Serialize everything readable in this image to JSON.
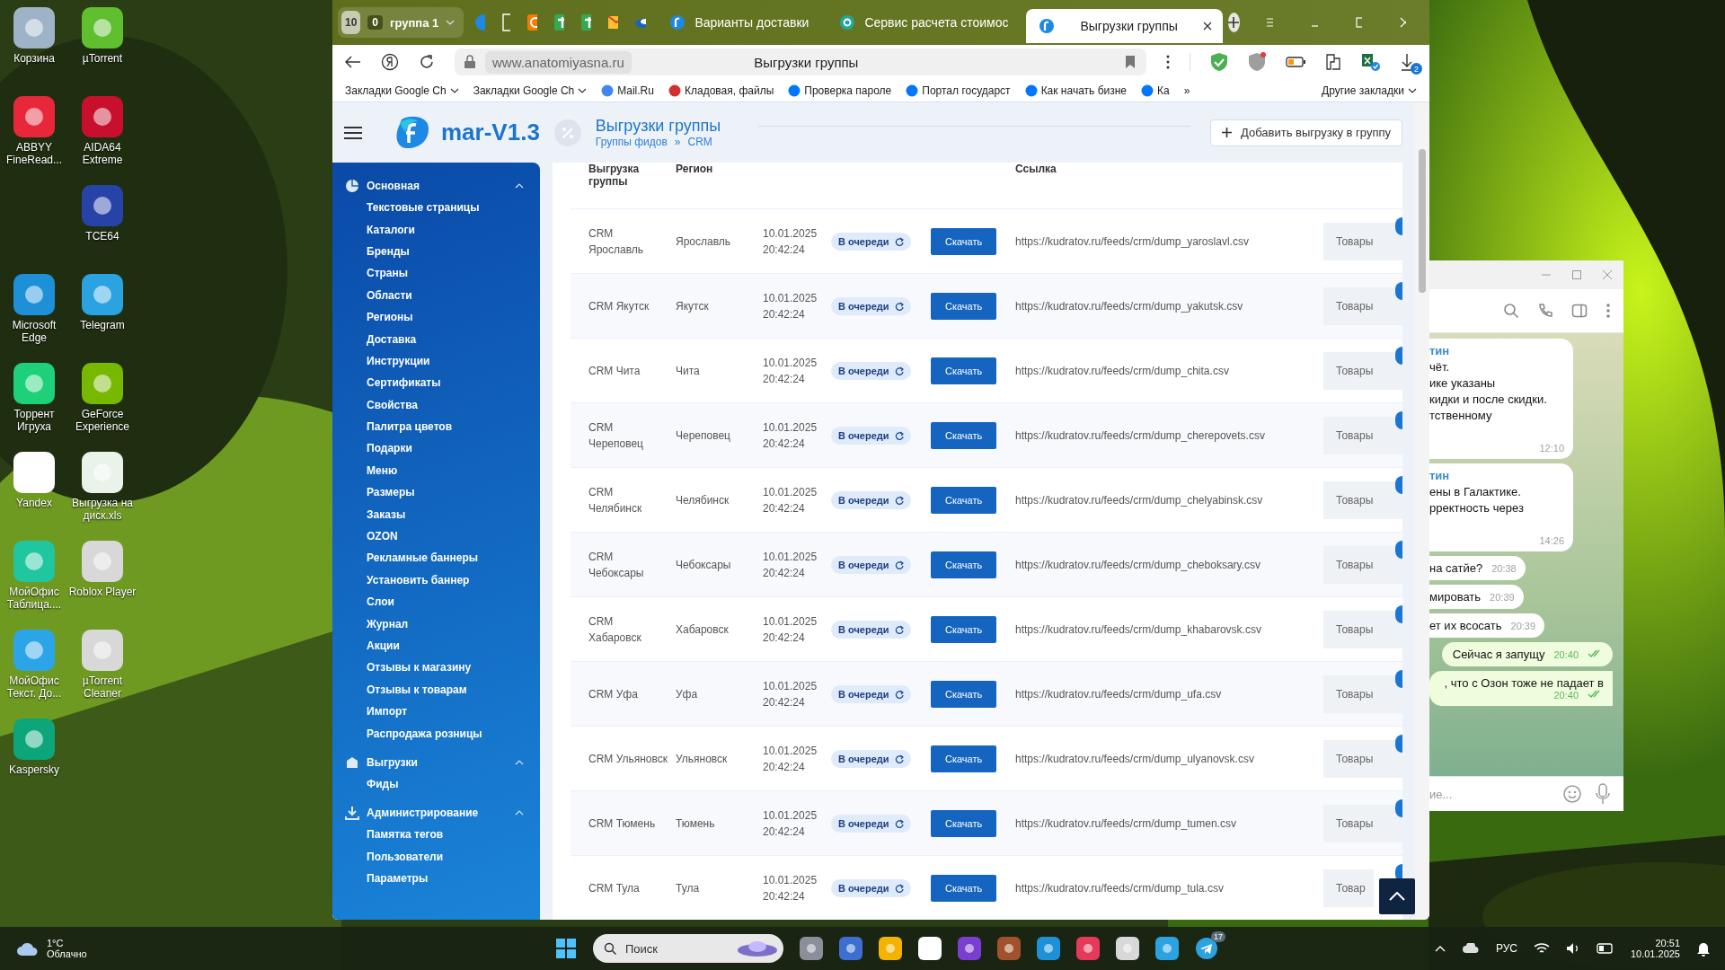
{
  "desktop": {
    "icons": [
      {
        "label": "Корзина"
      },
      {
        "label": "µTorrent"
      },
      {
        "label": "ABBYY FineRead..."
      },
      {
        "label": "AIDA64 Extreme"
      },
      {
        "label": "TCE64"
      },
      {
        "label": "Microsoft Edge"
      },
      {
        "label": "Telegram"
      },
      {
        "label": "Торрент Игруха"
      },
      {
        "label": "GeForce Experience"
      },
      {
        "label": "Yandex"
      },
      {
        "label": "Выгрузка на диск.xls"
      },
      {
        "label": "МойОфис Таблица...."
      },
      {
        "label": "Roblox Player"
      },
      {
        "label": "МойОфис Текст. До..."
      },
      {
        "label": "µTorrent Cleaner"
      },
      {
        "label": "Kaspersky"
      }
    ]
  },
  "browser": {
    "tab_group": {
      "count": "10",
      "badge": "0",
      "label": "группа 1"
    },
    "tabs": [
      {
        "title": "Варианты доставки",
        "selected": false
      },
      {
        "title": "Сервис расчета стоимос",
        "selected": false
      },
      {
        "title": "Выгрузки группы",
        "selected": true
      }
    ],
    "address": {
      "url": "www.anatomiyasna.ru",
      "page_title": "Выгрузки группы"
    },
    "download_badge": "2",
    "bookmarks": [
      {
        "label": "Закладки Google Ch",
        "kind": "folder"
      },
      {
        "label": "Закладки Google Ch",
        "kind": "folder"
      },
      {
        "label": "Mail.Ru",
        "kind": "link"
      },
      {
        "label": "Кладовая, файлы",
        "kind": "link"
      },
      {
        "label": "Проверка пароле",
        "kind": "link"
      },
      {
        "label": "Портал государст",
        "kind": "link"
      },
      {
        "label": "Как начать бизне",
        "kind": "link"
      },
      {
        "label": "Ка",
        "kind": "link"
      }
    ],
    "bookmarks_more": "»",
    "other_bookmarks": "Другие закладки"
  },
  "page": {
    "logo": "mar-V1.3",
    "title": "Выгрузки группы",
    "breadcrumbs": [
      "Группы фидов",
      "CRM"
    ],
    "breadcrumb_separator": "»",
    "add_button": "Добавить выгрузку в группу",
    "sidebar": [
      {
        "title": "Основная",
        "expanded": true,
        "items": [
          "Текстовые страницы",
          "Каталоги",
          "Бренды",
          "Страны",
          "Области",
          "Регионы",
          "Доставка",
          "Инструкции",
          "Сертификаты",
          "Свойства",
          "Палитра цветов",
          "Подарки",
          "Меню",
          "Размеры",
          "Заказы",
          "OZON",
          "Рекламные баннеры",
          "Установить баннер",
          "Слои",
          "Журнал",
          "Акции",
          "Отзывы к магазину",
          "Отзывы к товарам",
          "Импорт",
          "Распродажа розницы"
        ]
      },
      {
        "title": "Выгрузки",
        "expanded": true,
        "items": [
          "Фиды"
        ]
      },
      {
        "title": "Администрирование",
        "expanded": true,
        "items": [
          "Памятка тегов",
          "Пользователи",
          "Параметры"
        ]
      }
    ],
    "table": {
      "headers": {
        "group": "Выгрузка группы",
        "region": "Регион",
        "link": "Ссылка"
      },
      "rows": [
        {
          "group": "CRM Ярославль",
          "region": "Ярославль",
          "date": "10.01.2025",
          "time": "20:42:24",
          "status": "В очереди",
          "download": "Скачать",
          "link": "https://kudratov.ru/feeds/crm/dump_yaroslavl.csv",
          "products": "Товары"
        },
        {
          "group": "CRM Якутск",
          "region": "Якутск",
          "date": "10.01.2025",
          "time": "20:42:24",
          "status": "В очереди",
          "download": "Скачать",
          "link": "https://kudratov.ru/feeds/crm/dump_yakutsk.csv",
          "products": "Товары"
        },
        {
          "group": "CRM Чита",
          "region": "Чита",
          "date": "10.01.2025",
          "time": "20:42:24",
          "status": "В очереди",
          "download": "Скачать",
          "link": "https://kudratov.ru/feeds/crm/dump_chita.csv",
          "products": "Товары"
        },
        {
          "group": "CRM Череповец",
          "region": "Череповец",
          "date": "10.01.2025",
          "time": "20:42:24",
          "status": "В очереди",
          "download": "Скачать",
          "link": "https://kudratov.ru/feeds/crm/dump_cherepovets.csv",
          "products": "Товары"
        },
        {
          "group": "CRM Челябинск",
          "region": "Челябинск",
          "date": "10.01.2025",
          "time": "20:42:24",
          "status": "В очереди",
          "download": "Скачать",
          "link": "https://kudratov.ru/feeds/crm/dump_chelyabinsk.csv",
          "products": "Товары"
        },
        {
          "group": "CRM Чебоксары",
          "region": "Чебоксары",
          "date": "10.01.2025",
          "time": "20:42:24",
          "status": "В очереди",
          "download": "Скачать",
          "link": "https://kudratov.ru/feeds/crm/dump_cheboksary.csv",
          "products": "Товары"
        },
        {
          "group": "CRM Хабаровск",
          "region": "Хабаровск",
          "date": "10.01.2025",
          "time": "20:42:24",
          "status": "В очереди",
          "download": "Скачать",
          "link": "https://kudratov.ru/feeds/crm/dump_khabarovsk.csv",
          "products": "Товары"
        },
        {
          "group": "CRM Уфа",
          "region": "Уфа",
          "date": "10.01.2025",
          "time": "20:42:24",
          "status": "В очереди",
          "download": "Скачать",
          "link": "https://kudratov.ru/feeds/crm/dump_ufa.csv",
          "products": "Товары"
        },
        {
          "group": "CRM Ульяновск",
          "region": "Ульяновск",
          "date": "10.01.2025",
          "time": "20:42:24",
          "status": "В очереди",
          "download": "Скачать",
          "link": "https://kudratov.ru/feeds/crm/dump_ulyanovsk.csv",
          "products": "Товары"
        },
        {
          "group": "CRM Тюмень",
          "region": "Тюмень",
          "date": "10.01.2025",
          "time": "20:42:24",
          "status": "В очереди",
          "download": "Скачать",
          "link": "https://kudratov.ru/feeds/crm/dump_tumen.csv",
          "products": "Товары"
        },
        {
          "group": "CRM Тула",
          "region": "Тула",
          "date": "10.01.2025",
          "time": "20:42:24",
          "status": "В очереди",
          "download": "Скачать",
          "link": "https://kudratov.ru/feeds/crm/dump_tula.csv",
          "products": "Товар"
        }
      ]
    }
  },
  "telegram": {
    "messages": [
      {
        "kind": "incoming",
        "sender": "тин",
        "lines": [
          "чёт.",
          "ике указаны",
          "кидки и после скидки.",
          "тственному"
        ],
        "time": "12:10"
      },
      {
        "kind": "incoming",
        "sender": "тин",
        "lines": [
          "ены в Галактике.",
          "рректность через"
        ],
        "time": "14:26"
      },
      {
        "kind": "incoming",
        "lines": [
          "на сатйе?"
        ],
        "time": "20:38"
      },
      {
        "kind": "incoming",
        "lines": [
          "мировать"
        ],
        "time": "20:39"
      },
      {
        "kind": "incoming",
        "lines": [
          "ет их всосать"
        ],
        "time": "20:39"
      },
      {
        "kind": "outgoing",
        "lines": [
          "Сейчас я запущу"
        ],
        "time": "20:40",
        "read": true
      },
      {
        "kind": "outgoing",
        "lines": [
          ", что с Озон тоже не падает в"
        ],
        "time": "20:40",
        "read": true
      }
    ],
    "input_placeholder": "ие..."
  },
  "taskbar": {
    "temperature": "1°C",
    "weather": "Облачно",
    "search_placeholder": "Поиск",
    "telegram_badge": "17",
    "language": "РУС",
    "time": "20:51",
    "date": "10.01.2025"
  }
}
